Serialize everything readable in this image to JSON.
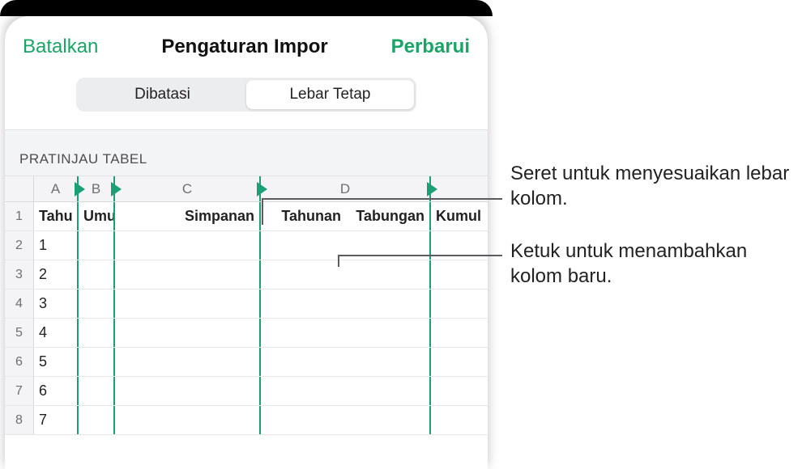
{
  "sheet": {
    "cancel_label": "Batalkan",
    "title": "Pengaturan Impor",
    "update_label": "Perbarui"
  },
  "segmented": {
    "option_delimited": "Dibatasi",
    "option_fixed": "Lebar Tetap"
  },
  "section_label": "PRATINJAU TABEL",
  "columns": {
    "A": "A",
    "B": "B",
    "C": "C",
    "D": "D"
  },
  "header_cells": {
    "A": "Tahu",
    "B": "Umu",
    "C": "Simpanan",
    "D_part1": "Tahunan",
    "D_part2": "Tabungan",
    "E": "Kumul"
  },
  "rows": [
    {
      "num": "1",
      "A": "Tahu"
    },
    {
      "num": "2",
      "A": "1"
    },
    {
      "num": "3",
      "A": "2"
    },
    {
      "num": "4",
      "A": "3"
    },
    {
      "num": "5",
      "A": "4"
    },
    {
      "num": "6",
      "A": "5"
    },
    {
      "num": "7",
      "A": "6"
    },
    {
      "num": "8",
      "A": "7"
    }
  ],
  "callouts": {
    "drag": "Seret untuk menyesuaikan lebar kolom.",
    "tap": "Ketuk untuk menambahkan kolom baru."
  },
  "colors": {
    "accent": "#1aa567",
    "separator": "#1aa074"
  }
}
